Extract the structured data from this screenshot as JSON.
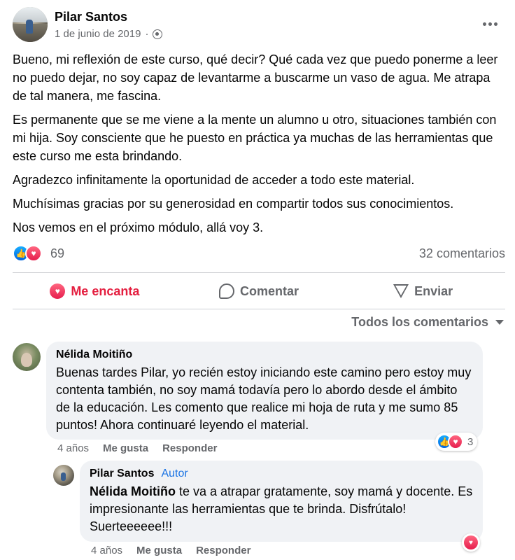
{
  "post": {
    "author": "Pilar Santos",
    "date": "1 de junio de 2019",
    "audience_icon": "group-icon",
    "paragraphs": [
      "Bueno, mi reflexión de este curso, qué decir? Qué cada vez que puedo ponerme a leer no puedo dejar, no soy capaz de levantarme a buscarme un vaso de agua. Me atrapa de tal manera, me fascina.",
      "Es permanente que se me viene a la mente un alumno u otro, situaciones también con mi hija. Soy consciente que he puesto en práctica ya muchas de las herramientas que este curso me esta brindando.",
      "Agradezco infinitamente la oportunidad de acceder a todo este material.",
      "Muchísimas gracias por su generosidad en compartir todos  sus conocimientos.",
      "Nos vemos en el próximo módulo, allá voy 3."
    ],
    "reaction_count": "69",
    "comment_count": "32 comentarios"
  },
  "actions": {
    "love_label": "Me encanta",
    "comment_label": "Comentar",
    "send_label": "Enviar"
  },
  "sort": {
    "label": "Todos los comentarios"
  },
  "comments": [
    {
      "name": "Nélida Moitiño",
      "text": "Buenas tardes Pilar, yo recién estoy iniciando este camino pero estoy muy contenta también, no soy mamá todavía pero lo abordo desde el ámbito de la educación. Les comento que realice mi hoja de ruta y me sumo 85 puntos! Ahora continuaré leyendo el material.",
      "time": "4 años",
      "like_label": "Me gusta",
      "reply_label": "Responder",
      "reaction_count": "3"
    },
    {
      "name": "Pilar Santos",
      "badge": "Autor",
      "mention": "Nélida Moitiño",
      "text": " te va a atrapar gratamente, soy mamá y docente. Es impresionante las herramientas que te brinda. Disfrútalo! Suerteeeeee!!!",
      "time": "4 años",
      "like_label": "Me gusta",
      "reply_label": "Responder"
    }
  ],
  "colors": {
    "love_red": "#e41e3f",
    "like_blue": "#0165e1",
    "author_badge_blue": "#1b74e4",
    "secondary_text": "#65676b",
    "bubble_bg": "#f0f2f5"
  }
}
